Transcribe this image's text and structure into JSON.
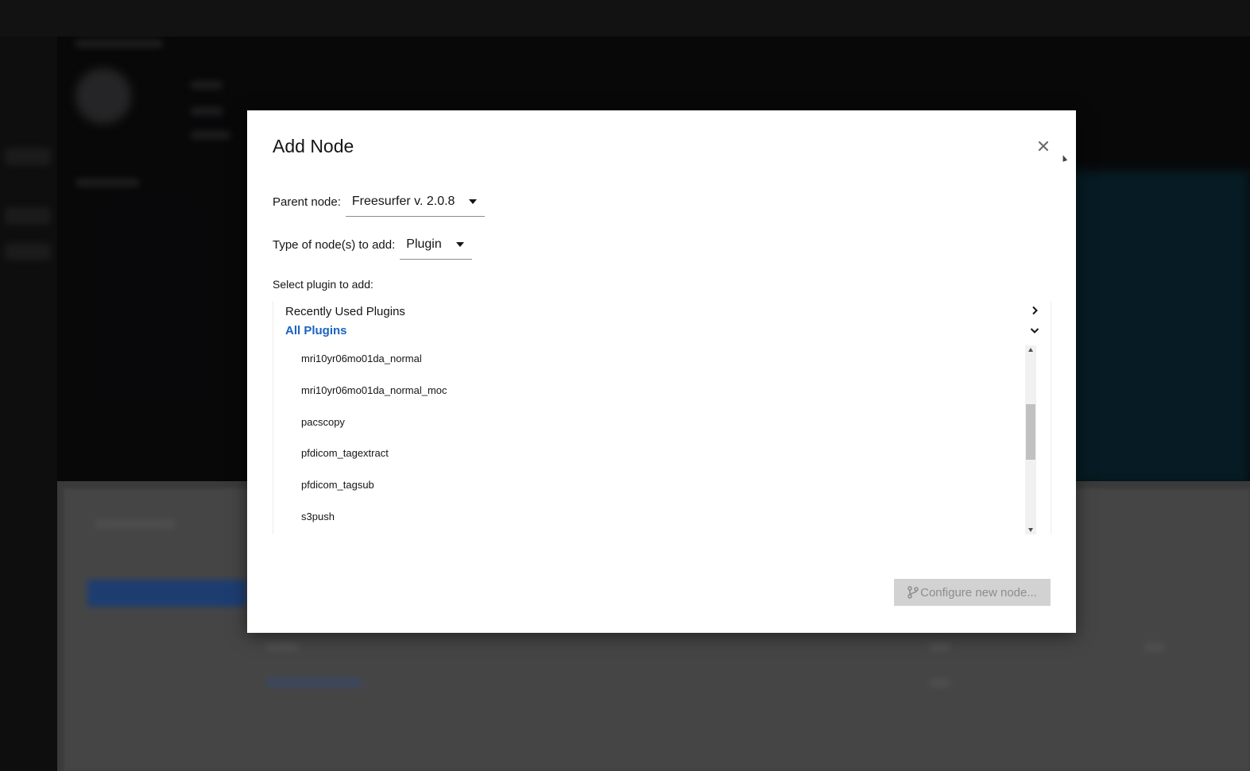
{
  "modal": {
    "title": "Add Node",
    "close_icon": "close-icon",
    "parent_node": {
      "label": "Parent node:",
      "value": "Freesurfer v. 2.0.8"
    },
    "node_type": {
      "label": "Type of node(s) to add:",
      "value": "Plugin"
    },
    "select_plugin_label": "Select plugin to add:",
    "groups": {
      "recent": {
        "label": "Recently Used Plugins",
        "expanded": false
      },
      "all": {
        "label": "All Plugins",
        "expanded": true
      }
    },
    "plugins": [
      "mri10yr06mo01da_normal",
      "mri10yr06mo01da_normal_moc",
      "pacscopy",
      "pfdicom_tagextract",
      "pfdicom_tagsub",
      "s3push"
    ],
    "configure_button": {
      "label": "Configure new node...",
      "icon": "branch-icon",
      "disabled": true
    }
  },
  "colors": {
    "link_blue": "#1a63c2",
    "disabled_button_bg": "#d2d2d2",
    "disabled_button_text": "#8a8d90"
  }
}
